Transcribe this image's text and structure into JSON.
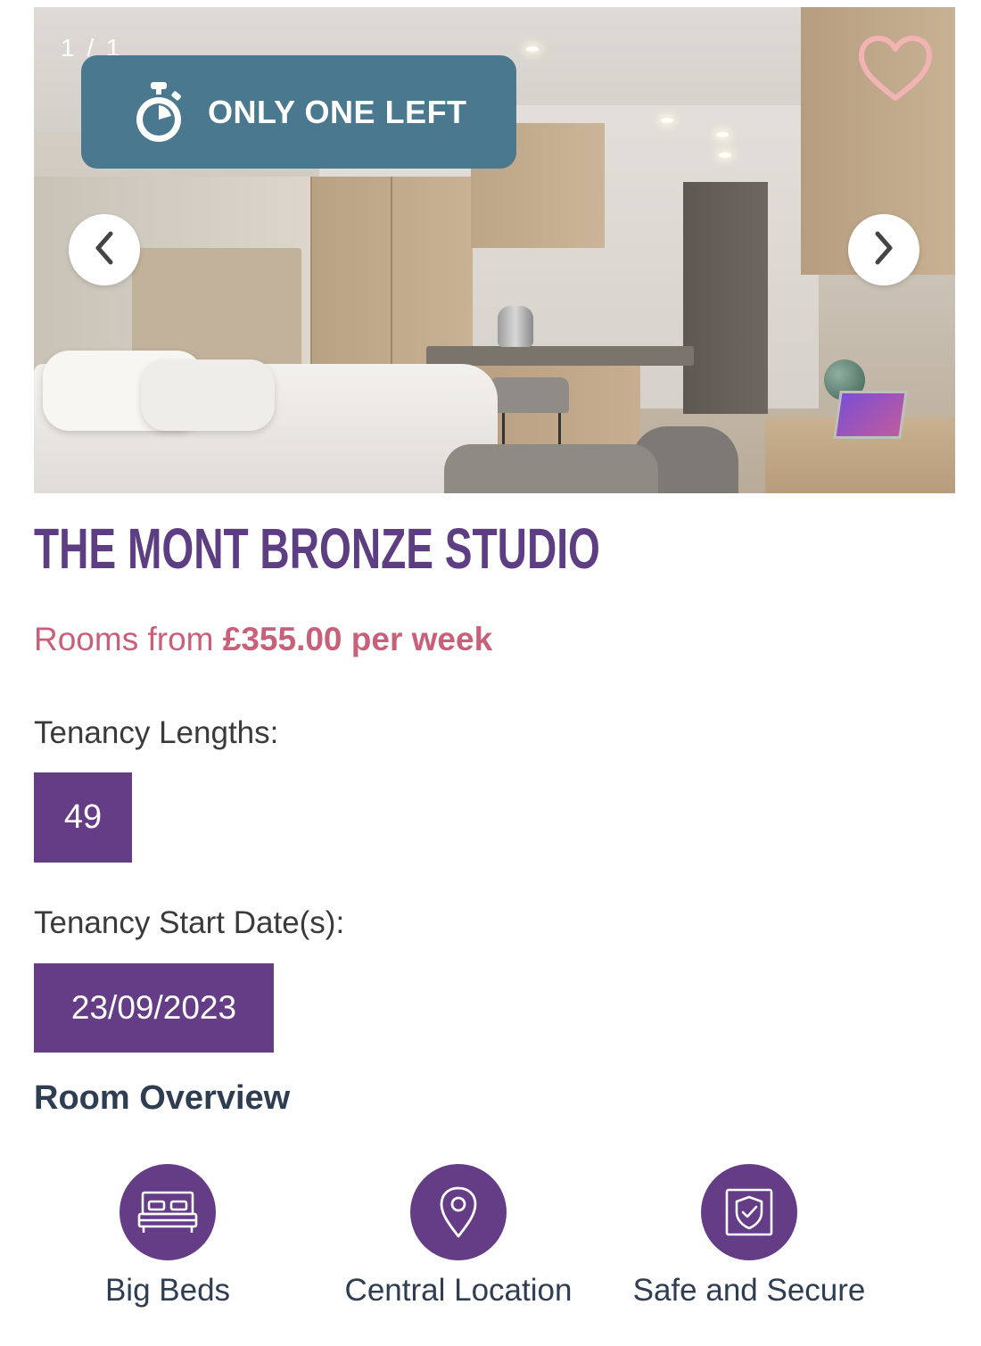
{
  "gallery": {
    "counter": "1 / 1",
    "badge_text": "ONLY ONE LEFT",
    "icons": {
      "stopwatch": "stopwatch-icon",
      "favorite": "heart-icon",
      "prev": "chevron-left-icon",
      "next": "chevron-right-icon"
    }
  },
  "room": {
    "title": "THE MONT BRONZE STUDIO",
    "price_prefix": "Rooms from ",
    "price_amount": "£355.00",
    "price_unit": " per week"
  },
  "tenancy": {
    "lengths_label": "Tenancy Lengths:",
    "lengths": [
      "49"
    ],
    "start_label": "Tenancy Start Date(s):",
    "start_dates": [
      "23/09/2023"
    ]
  },
  "overview": {
    "title": "Room Overview",
    "features": [
      {
        "label": "Big Beds",
        "icon": "bed-icon"
      },
      {
        "label": "Central Location",
        "icon": "location-pin-icon"
      },
      {
        "label": "Safe and Secure",
        "icon": "shield-icon"
      }
    ]
  },
  "colors": {
    "brand_purple": "#653c86",
    "title_purple": "#5e3e82",
    "price_pink": "#c8607a",
    "badge_teal": "#4a788f",
    "heart_pink": "#f2b3b3"
  }
}
